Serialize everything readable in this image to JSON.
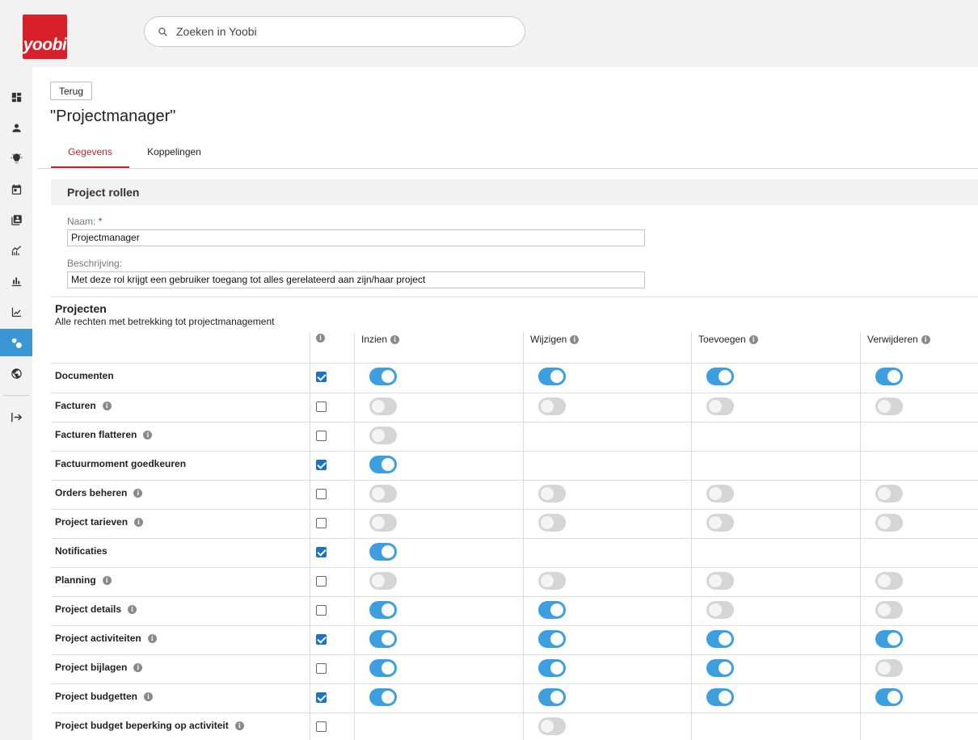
{
  "app": {
    "logo_text": "yoobi",
    "brand_color": "#d8202a",
    "accent_color": "#3d9ee0"
  },
  "search": {
    "placeholder": "Zoeken in Yoobi",
    "value": ""
  },
  "sidebar": {
    "items": [
      {
        "icon": "dashboard-icon",
        "active": false
      },
      {
        "icon": "person-icon",
        "active": false
      },
      {
        "icon": "lightbulb-icon",
        "active": false
      },
      {
        "icon": "calendar-icon",
        "active": false
      },
      {
        "icon": "contacts-book-icon",
        "active": false
      },
      {
        "icon": "trend-chart-icon",
        "active": false
      },
      {
        "icon": "bar-chart-icon",
        "active": false
      },
      {
        "icon": "line-chart-icon",
        "active": false
      },
      {
        "icon": "settings-gears-icon",
        "active": true
      },
      {
        "icon": "globe-icon",
        "active": false
      }
    ],
    "logout_icon": "logout-arrow-icon"
  },
  "page": {
    "back_label": "Terug",
    "title": "\"Projectmanager\"",
    "tabs": [
      {
        "label": "Gegevens",
        "active": true
      },
      {
        "label": "Koppelingen",
        "active": false
      }
    ]
  },
  "section": {
    "title": "Project rollen",
    "name_label": "Naam:",
    "name_required": "*",
    "name_value": "Projectmanager",
    "desc_label": "Beschrijving:",
    "desc_value": "Met deze rol krijgt een gebruiker toegang tot alles gerelateerd aan zijn/haar project"
  },
  "permissions": {
    "heading": "Projecten",
    "subheading": "Alle rechten met betrekking tot projectmanagement",
    "columns": [
      "Inzien",
      "Wijzigen",
      "Toevoegen",
      "Verwijderen"
    ],
    "rows": [
      {
        "label": "Documenten",
        "info": false,
        "checked": true,
        "toggles": [
          true,
          true,
          true,
          true
        ]
      },
      {
        "label": "Facturen",
        "info": true,
        "checked": false,
        "toggles": [
          false,
          false,
          false,
          false
        ]
      },
      {
        "label": "Facturen flatteren",
        "info": true,
        "checked": false,
        "toggles": [
          false,
          null,
          null,
          null
        ]
      },
      {
        "label": "Factuurmoment goedkeuren",
        "info": false,
        "checked": true,
        "toggles": [
          true,
          null,
          null,
          null
        ]
      },
      {
        "label": "Orders beheren",
        "info": true,
        "checked": false,
        "toggles": [
          false,
          false,
          false,
          false
        ]
      },
      {
        "label": "Project tarieven",
        "info": true,
        "checked": false,
        "toggles": [
          false,
          false,
          false,
          false
        ]
      },
      {
        "label": "Notificaties",
        "info": false,
        "checked": true,
        "toggles": [
          true,
          null,
          null,
          null
        ]
      },
      {
        "label": "Planning",
        "info": true,
        "checked": false,
        "toggles": [
          false,
          false,
          false,
          false
        ]
      },
      {
        "label": "Project details",
        "info": true,
        "checked": false,
        "toggles": [
          true,
          true,
          false,
          false
        ]
      },
      {
        "label": "Project activiteiten",
        "info": true,
        "checked": true,
        "toggles": [
          true,
          true,
          true,
          true
        ]
      },
      {
        "label": "Project bijlagen",
        "info": true,
        "checked": false,
        "toggles": [
          true,
          true,
          true,
          false
        ]
      },
      {
        "label": "Project budgetten",
        "info": true,
        "checked": true,
        "toggles": [
          true,
          true,
          true,
          true
        ]
      },
      {
        "label": "Project budget beperking op activiteit",
        "info": true,
        "checked": false,
        "toggles": [
          null,
          false,
          null,
          null
        ]
      }
    ]
  }
}
